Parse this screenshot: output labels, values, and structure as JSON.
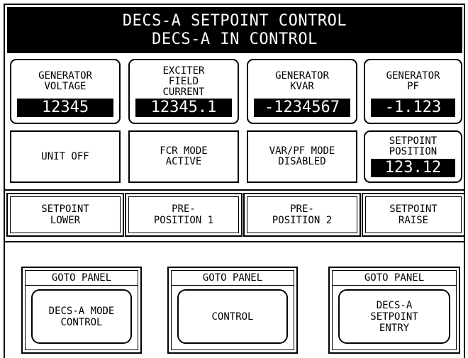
{
  "header": {
    "title_line1": "DECS-A SETPOINT CONTROL",
    "title_line2": "DECS-A IN CONTROL"
  },
  "meters": [
    {
      "label": "GENERATOR\nVOLTAGE",
      "value": "12345"
    },
    {
      "label": "EXCITER\nFIELD\nCURRENT",
      "value": "12345.1"
    },
    {
      "label": "GENERATOR\nKVAR",
      "value": "-1234567"
    },
    {
      "label": "GENERATOR\nPF",
      "value": "-1.123"
    }
  ],
  "status": {
    "unit": "UNIT OFF",
    "fcr": "FCR MODE\nACTIVE",
    "varpf": "VAR/PF MODE\nDISABLED",
    "setpoint_label": "SETPOINT\nPOSITION",
    "setpoint_value": "123.12"
  },
  "controls": {
    "lower": "SETPOINT\nLOWER",
    "preposition1": "PRE-\nPOSITION 1",
    "preposition2": "PRE-\nPOSITION 2",
    "raise": "SETPOINT\nRAISE"
  },
  "goto_panels": [
    {
      "header": "GOTO PANEL",
      "label": "DECS-A MODE\nCONTROL"
    },
    {
      "header": "GOTO PANEL",
      "label": "CONTROL"
    },
    {
      "header": "GOTO PANEL",
      "label": "DECS-A\nSETPOINT\nENTRY"
    }
  ],
  "colors": {
    "foreground": "#000000",
    "background": "#ffffff"
  }
}
